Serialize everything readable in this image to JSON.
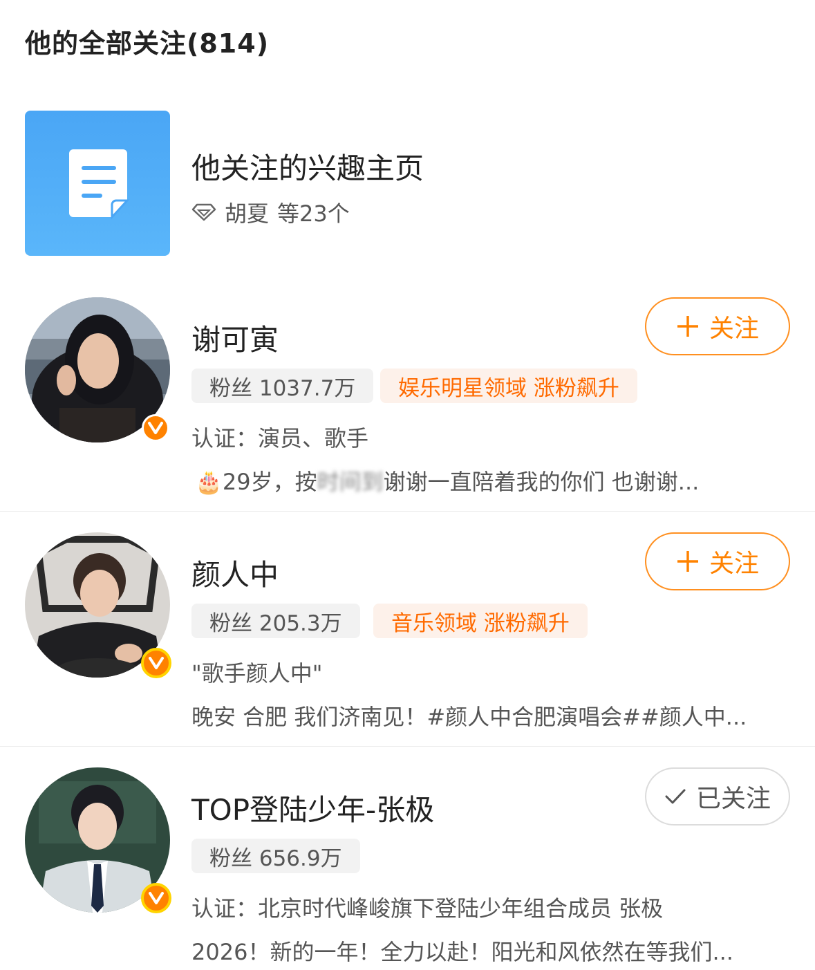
{
  "page": {
    "title": "他的全部关注(814)"
  },
  "interest": {
    "title": "他关注的兴趣主页",
    "subtitle_name": "胡夏",
    "subtitle_count": "等23个",
    "icon": "document-icon"
  },
  "users": [
    {
      "name": "谢可寅",
      "fans": "粉丝 1037.7万",
      "tag": "娱乐明星领域 涨粉飙升",
      "desc": "认证：演员、歌手",
      "snippet_emoji": "🎂",
      "snippet_pre": "29岁，按",
      "snippet_blurred": "时间到",
      "snippet_post": "谢谢一直陪着我的你们 也谢谢...",
      "follow_label": "关注",
      "followed": false
    },
    {
      "name": "颜人中",
      "fans": "粉丝 205.3万",
      "tag": "音乐领域 涨粉飙升",
      "desc": "\"歌手颜人中\"",
      "snippet": "晚安 合肥 我们济南见！#颜人中合肥演唱会##颜人中...",
      "follow_label": "关注",
      "followed": false
    },
    {
      "name": "TOP登陆少年-张极",
      "fans": "粉丝 656.9万",
      "desc": "认证：北京时代峰峻旗下登陆少年组合成员 张极",
      "snippet": "2026！新的一年！全力以赴！阳光和风依然在等我们...",
      "follow_label": "已关注",
      "followed": true
    }
  ],
  "colors": {
    "accent": "#ff8200",
    "tag_bg": "#fdf1ea",
    "pill_bg": "#f2f2f2",
    "tile_blue": "#4aa6f5"
  }
}
